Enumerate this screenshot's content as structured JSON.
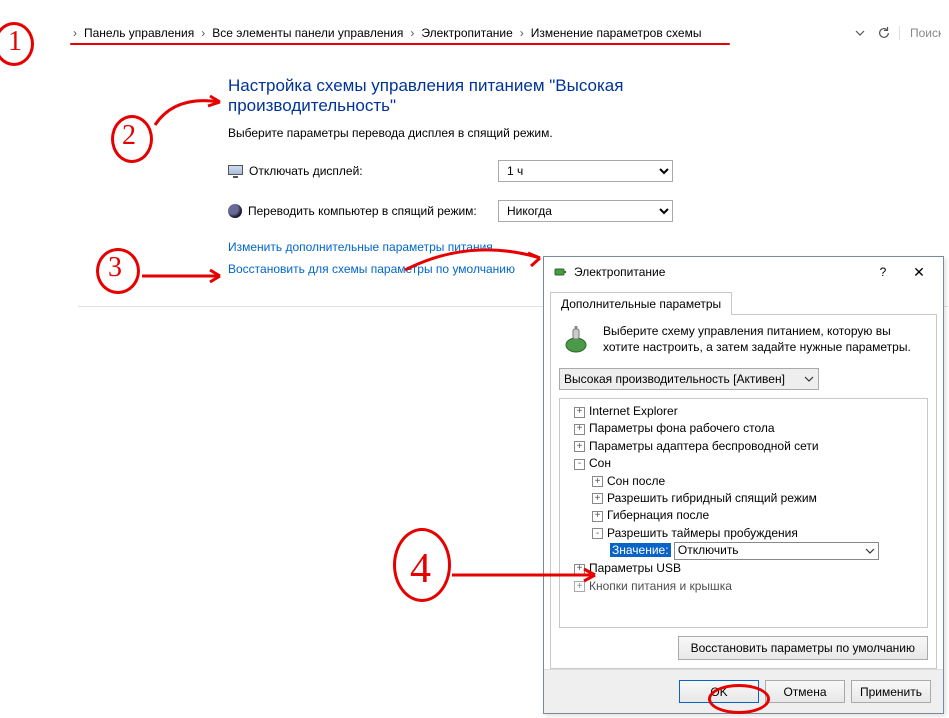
{
  "breadcrumb": {
    "items": [
      "Панель управления",
      "Все элементы панели управления",
      "Электропитание",
      "Изменение параметров схемы"
    ]
  },
  "search": {
    "placeholder": "Поиск в"
  },
  "page": {
    "title": "Настройка схемы управления питанием \"Высокая производительность\"",
    "subtitle": "Выберите параметры перевода дисплея в спящий режим.",
    "row_display": "Отключать дисплей:",
    "row_sleep": "Переводить компьютер в спящий режим:",
    "display_value": "1 ч",
    "sleep_value": "Никогда",
    "link_advanced": "Изменить дополнительные параметры питания",
    "link_restore": "Восстановить для схемы параметры по умолчанию"
  },
  "dialog": {
    "title": "Электропитание",
    "tab": "Дополнительные параметры",
    "desc": "Выберите схему управления питанием, которую вы хотите настроить, а затем задайте нужные параметры.",
    "scheme": "Высокая производительность [Активен]",
    "tree": {
      "ie": "Internet Explorer",
      "bg": "Параметры фона рабочего стола",
      "wifi": "Параметры адаптера беспроводной сети",
      "sleep": "Сон",
      "sleep_after": "Сон после",
      "hybrid": "Разрешить гибридный спящий режим",
      "hiber": "Гибернация после",
      "timers": "Разрешить таймеры пробуждения",
      "val_label": "Значение:",
      "val_value": "Отключить",
      "usb": "Параметры USB",
      "lid": "Кнопки питания и крышка"
    },
    "restore_btn": "Восстановить параметры по умолчанию",
    "ok": "OK",
    "cancel": "Отмена",
    "apply": "Применить"
  },
  "annotations": {
    "n1": "1",
    "n2": "2",
    "n3": "3",
    "n4": "4"
  }
}
